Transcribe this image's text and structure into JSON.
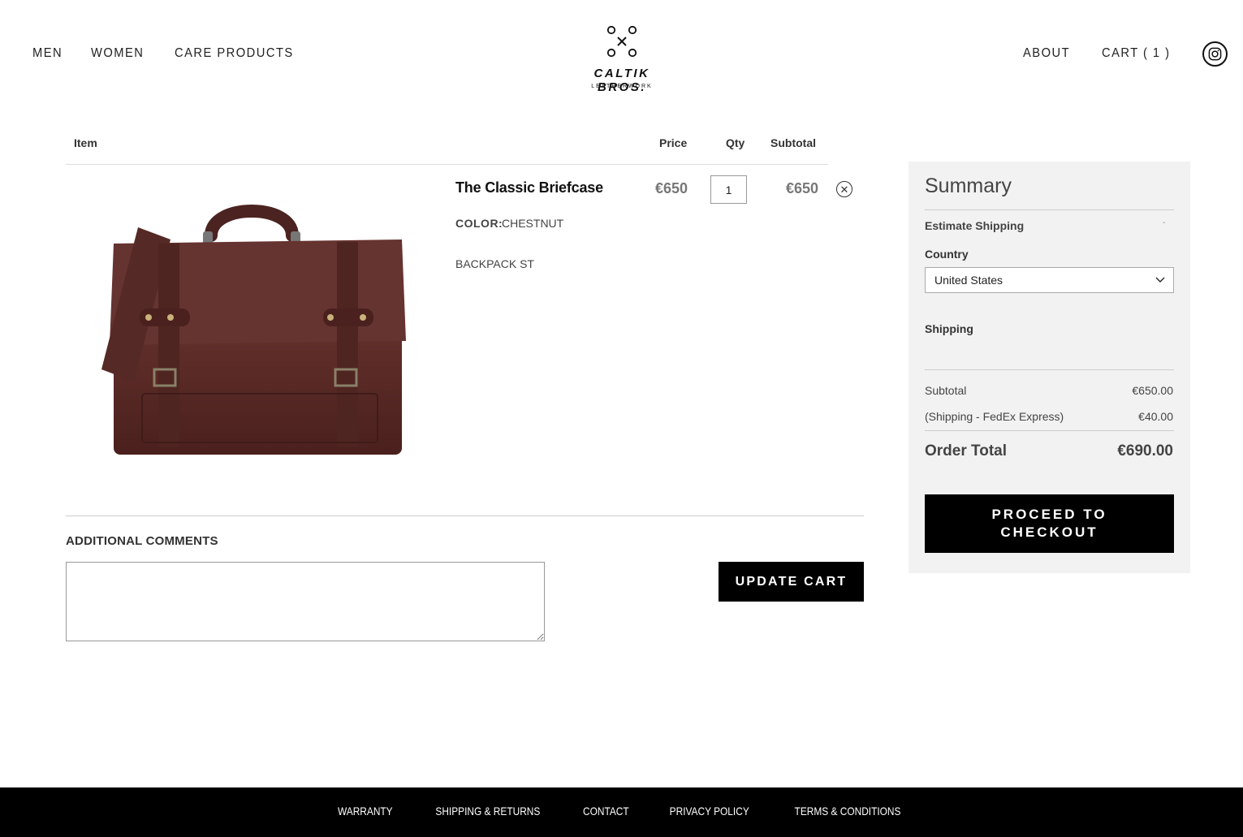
{
  "header": {
    "nav_left": [
      "MEN",
      "WOMEN",
      "CARE PRODUCTS"
    ],
    "nav_right": [
      "ABOUT",
      "CART ( 1 )"
    ],
    "logo_text": "CALTIK BROS.",
    "logo_sub": "LEATHERWORK",
    "social_icon": "instagram-icon"
  },
  "cart": {
    "columns": {
      "item": "Item",
      "price": "Price",
      "qty": "Qty",
      "subtotal": "Subtotal"
    },
    "items": [
      {
        "name": "The Classic Briefcase",
        "color_label": "COLOR:",
        "color_value": "CHESTNUT",
        "variant": "BACKPACK ST",
        "price": "€650",
        "qty": "1",
        "subtotal": "€650",
        "image_color": "#5a2a25"
      }
    ],
    "comments_title": "ADDITIONAL COMMENTS",
    "update_label": "UPDATE CART"
  },
  "summary": {
    "title": "Summary",
    "estimate_shipping": "Estimate Shipping",
    "estimate_toggle": "-",
    "country_label": "Country",
    "country_value": "United States",
    "shipping_label": "Shipping",
    "subtotal_label": "Subtotal",
    "subtotal_value": "€650.00",
    "shipping_method_label": "(Shipping - FedEx Express)",
    "shipping_method_value": "€40.00",
    "order_total_label": "Order Total",
    "order_total_value": "€690.00",
    "checkout_label": "PROCEED TO CHECKOUT"
  },
  "footer": {
    "links": [
      "WARRANTY",
      "SHIPPING & RETURNS",
      "CONTACT",
      "PRIVACY POLICY",
      "TERMS & CONDITIONS"
    ]
  },
  "colors": {
    "accent": "#000000",
    "summary_bg": "#f2f2f2",
    "footer_bg": "#000000"
  }
}
